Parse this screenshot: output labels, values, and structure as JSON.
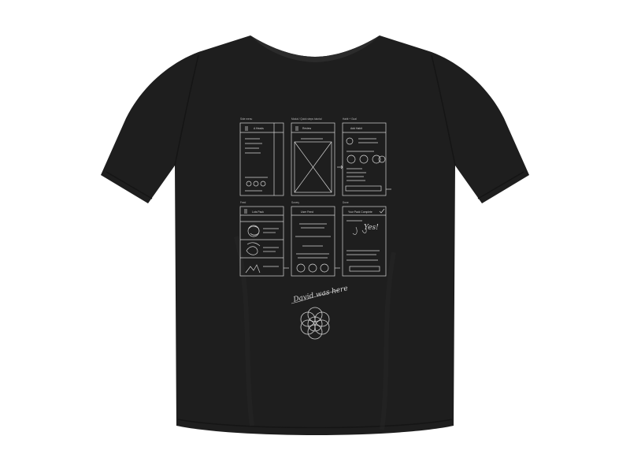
{
  "product": {
    "shirt_color": "#1e1e1e",
    "print_color": "#d4d4d4",
    "background_color": "#ffffff"
  },
  "print": {
    "signature_text": "David was here",
    "logo_icon": "overlapping-circles-icon",
    "annotation_text": "Yes!"
  }
}
